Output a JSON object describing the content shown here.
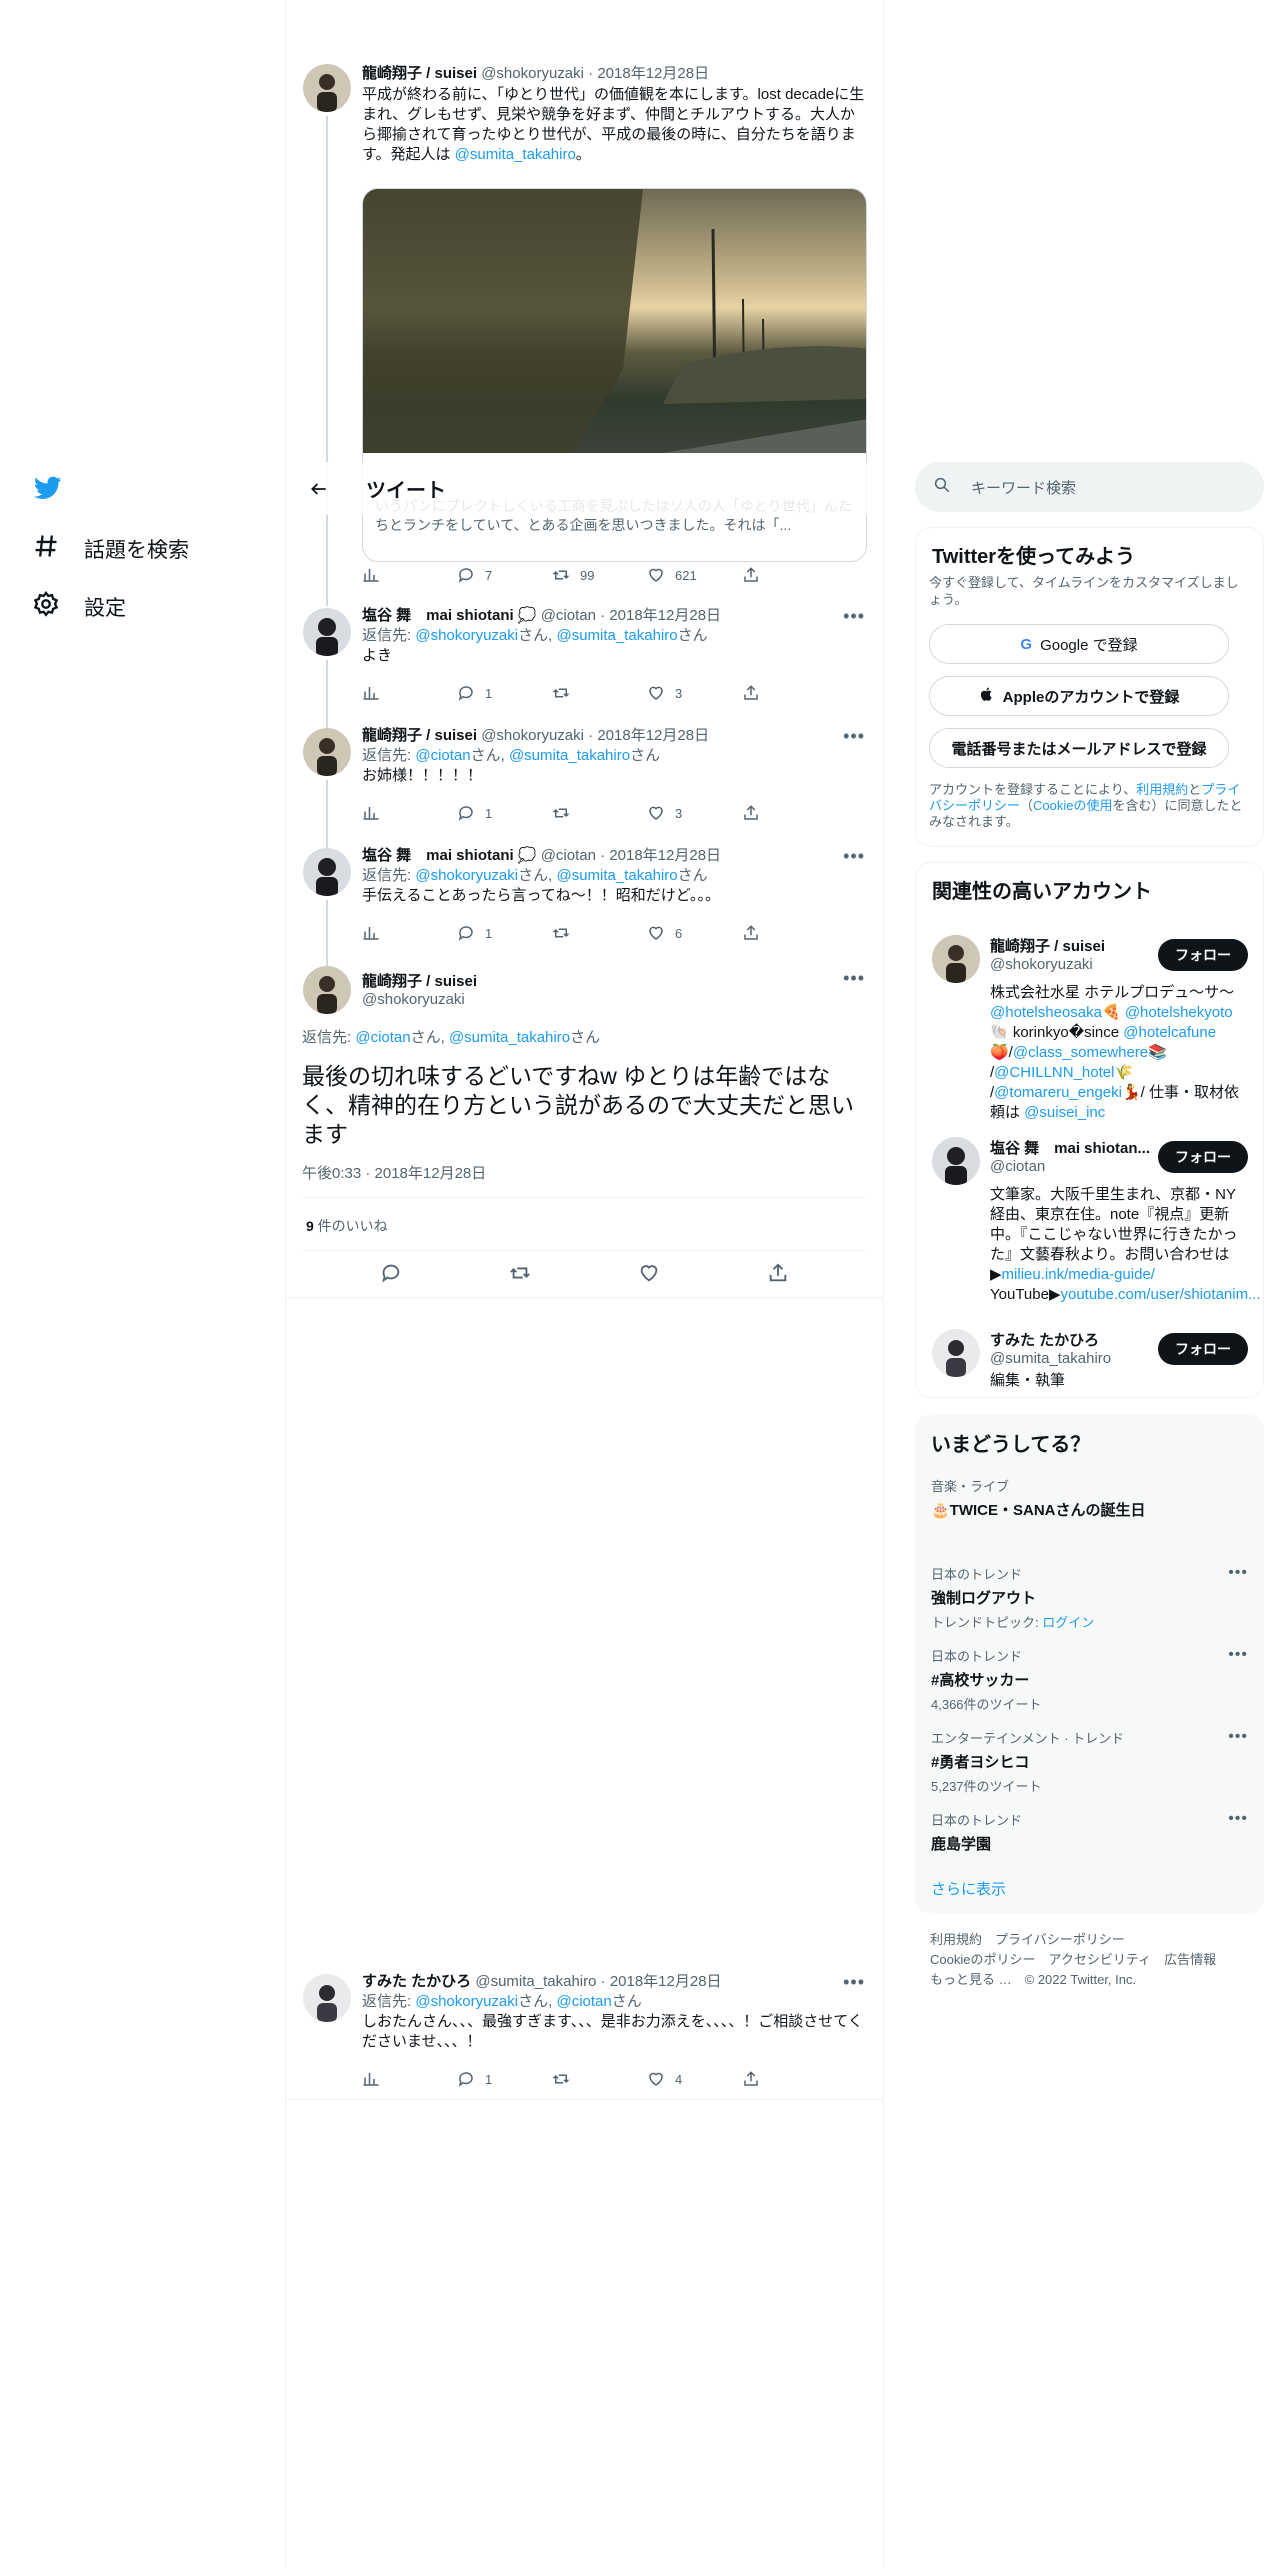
{
  "nav": {
    "logo": "twitter-bird",
    "explore_label": "話題を検索",
    "settings_label": "設定"
  },
  "header": {
    "title": "ツイート"
  },
  "main_tweet": {
    "name": "龍崎翔子 / suisei",
    "handle": "@shokoryuzaki",
    "date": "2018年12月28日",
    "text_prefix": "平成が終わる前に、「ゆとり世代」の価値観を本にします。lost decadeに生まれ、グレもせず、見栄や競争を好まず、仲間とチルアウトする。大人から揶揄されて育ったゆとり世代が、平成の最後の時に、自分たちを語ります。発起人は ",
    "text_link": "@sumita_takahiro",
    "text_suffix": "。",
    "card_text": "いうパンにプレクトしくいる工商を見ぶしたはソ人の人「ゆとり世代」んたちとランチをしていて、とある企画を思いつきました。それは「...",
    "views_icon": "chart-icon",
    "replies": "7",
    "retweets": "99",
    "likes": "621"
  },
  "replies": [
    {
      "name": "塩谷 舞　mai shiotani 💭",
      "handle": "@ciotan",
      "date": "2018年12月28日",
      "reply_label": "返信先: ",
      "reply_to_1": "@shokoryuzaki",
      "sep": "さん, ",
      "reply_to_2": "@sumita_takahiro",
      "suffix": "さん",
      "text": "よき",
      "replies": "1",
      "retweets": "",
      "likes": "3"
    },
    {
      "name": "龍崎翔子 / suisei",
      "handle": "@shokoryuzaki",
      "date": "2018年12月28日",
      "reply_label": "返信先: ",
      "reply_to_1": "@ciotan",
      "sep": "さん, ",
      "reply_to_2": "@sumita_takahiro",
      "suffix": "さん",
      "text": "お姉様！！！！！",
      "replies": "1",
      "retweets": "",
      "likes": "3"
    },
    {
      "name": "塩谷 舞　mai shiotani 💭",
      "handle": "@ciotan",
      "date": "2018年12月28日",
      "reply_label": "返信先: ",
      "reply_to_1": "@shokoryuzaki",
      "sep": "さん, ",
      "reply_to_2": "@sumita_takahiro",
      "suffix": "さん",
      "text": "手伝えることあったら言ってね〜！！昭和だけど。。。",
      "replies": "1",
      "retweets": "",
      "likes": "6"
    }
  ],
  "focus_tweet": {
    "name": "龍崎翔子 / suisei",
    "handle": "@shokoryuzaki",
    "reply_label": "返信先: ",
    "reply_to_1": "@ciotan",
    "sep": "さん, ",
    "reply_to_2": "@sumita_takahiro",
    "suffix": "さん",
    "text": "最後の切れ味するどいですねw ゆとりは年齢ではなく、精神的在り方という説があるので大丈夫だと思います",
    "timestamp": "午後0:33 · 2018年12月28日",
    "likes_count": "9",
    "likes_label": " 件のいいね"
  },
  "bottom_tweet": {
    "name": "すみた たかひろ",
    "handle": "@sumita_takahiro",
    "date": "2018年12月28日",
    "reply_label": "返信先: ",
    "reply_to_1": "@shokoryuzaki",
    "sep": "さん, ",
    "reply_to_2": "@ciotan",
    "suffix": "さん",
    "text": "しおたんさん、、、最強すぎます、、、是非お力添えを、、、、！ご相談させてくださいませ、、、！",
    "replies": "1",
    "retweets": "",
    "likes": "4"
  },
  "search": {
    "placeholder": "キーワード検索"
  },
  "signup": {
    "title": "Twitterを使ってみよう",
    "subtitle": "今すぐ登録して、タイムラインをカスタマイズしましょう。",
    "google_label": "Google で登録",
    "apple_label": "Appleのアカウントで登録",
    "phone_label": "電話番号またはメールアドレスで登録",
    "legal_1": "アカウントを登録することにより、",
    "legal_terms": "利用規約",
    "legal_2": "と",
    "legal_privacy": "プライバシーポリシー",
    "legal_3": "（",
    "legal_cookie": "Cookieの使用",
    "legal_4": "を含む）に同意したとみなされます。"
  },
  "related": {
    "title": "関連性の高いアカウント",
    "follow_label": "フォロー",
    "accounts": [
      {
        "name": "龍崎翔子 / suisei",
        "handle": "@shokoryuzaki",
        "bio_1": "株式会社水星 ホテルプロデュ〜サ〜",
        "bio_2": "@hotelsheosaka",
        "bio_3": "🍕 ",
        "bio_4": "@hotelshekyoto",
        "bio_5": "🐚 korinkyo�since ",
        "bio_6": "@hotelcafune",
        "bio_7": "🍑/",
        "bio_8": "@class_somewhere",
        "bio_9": "📚 /",
        "bio_10": "@CHILLNN_hotel",
        "bio_11": "🌾 /",
        "bio_12": "@tomareru_engeki",
        "bio_13": "💃/ 仕事・取材依頼は ",
        "bio_14": "@suisei_inc"
      },
      {
        "name": "塩谷 舞　mai shiotan...",
        "handle": "@ciotan",
        "bio_1": "文筆家。大阪千里生まれ、京都・NY経由、東京在住。note『視点』更新中。『ここじゃない世界に行きたかった』文藝春秋より。お問い合わせは▶",
        "bio_link_1": "milieu.ink/media-guide/",
        "bio_2": " YouTube▶",
        "bio_link_2": "youtube.com/user/shiotanim..."
      },
      {
        "name": "すみた たかひろ",
        "handle": "@sumita_takahiro",
        "bio_1": "編集・執筆"
      }
    ]
  },
  "trends": {
    "title": "いまどうしてる？",
    "items": [
      {
        "category": "音楽・ライブ",
        "name": "🎂TWICE・SANAさんの誕生日",
        "sub": ""
      },
      {
        "category": "日本のトレンド",
        "name": "強制ログアウト",
        "sub_label": "トレンドトピック: ",
        "sub_link": "ログイン"
      },
      {
        "category": "日本のトレンド",
        "name": "#高校サッカー",
        "sub": "4,366件のツイート"
      },
      {
        "category": "エンターテインメント · トレンド",
        "name": "#勇者ヨシヒコ",
        "sub": "5,237件のツイート"
      },
      {
        "category": "日本のトレンド",
        "name": "鹿島学園",
        "sub": ""
      }
    ],
    "show_more": "さらに表示"
  },
  "footer": {
    "terms": "利用規約",
    "privacy": "プライバシーポリシー",
    "cookie": "Cookieのポリシー",
    "accessibility": "アクセシビリティ",
    "ads": "広告情報",
    "more": "もっと見る …",
    "copyright": "© 2022 Twitter, Inc."
  },
  "colors": {
    "accent": "#1d9bf0",
    "text": "#0f1419",
    "muted": "#536471",
    "border": "#eff3f4"
  }
}
